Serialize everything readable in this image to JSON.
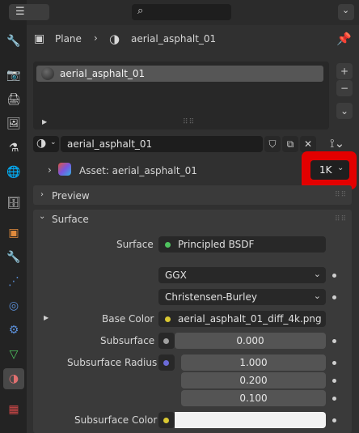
{
  "breadcrumb": {
    "object": "Plane",
    "material": "aerial_asphalt_01"
  },
  "slot_list": {
    "items": [
      "aerial_asphalt_01"
    ]
  },
  "material_selector": {
    "name": "aerial_asphalt_01"
  },
  "asset": {
    "label": "Asset: aerial_asphalt_01",
    "resolution": "1K"
  },
  "sections": {
    "preview": "Preview",
    "surface": "Surface"
  },
  "surface": {
    "surface_label": "Surface",
    "surface_value": "Principled BSDF",
    "distribution": "GGX",
    "subsurface_method": "Christensen-Burley",
    "base_color_label": "Base Color",
    "base_color_value": "aerial_asphalt_01_diff_4k.png",
    "subsurface_label": "Subsurface",
    "subsurface_value": "0.000",
    "subsurface_radius_label": "Subsurface Radius",
    "subsurface_radius": [
      "1.000",
      "0.200",
      "0.100"
    ],
    "subsurface_color_label": "Subsurface Color"
  },
  "colors": {
    "highlight": "#e30000",
    "green_socket": "#4fc35f",
    "yellow_socket": "#d9c832",
    "gray_socket": "#a0a0a0",
    "purple_socket": "#6b6bd9"
  }
}
